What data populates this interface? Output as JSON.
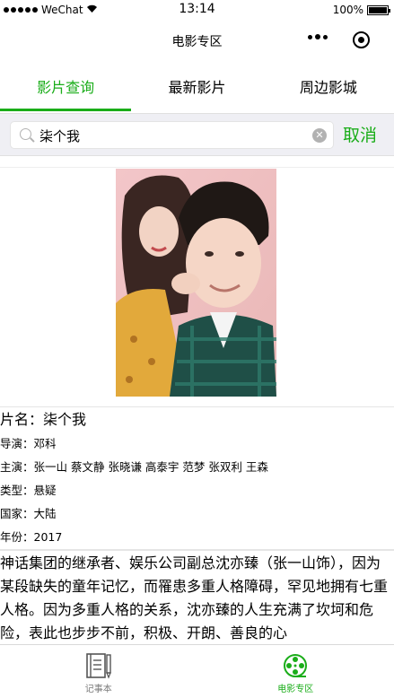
{
  "status_bar": {
    "carrier": "WeChat",
    "time": "13:14",
    "battery": "100%",
    "battery_level": 1.0
  },
  "nav": {
    "title": "电影专区"
  },
  "tabs": [
    {
      "label": "影片查询",
      "active": true
    },
    {
      "label": "最新影片",
      "active": false
    },
    {
      "label": "周边影城",
      "active": false
    }
  ],
  "search": {
    "value": "柒个我",
    "cancel_label": "取消"
  },
  "movie": {
    "name": "片名：柒个我",
    "director": "导演：邓科",
    "cast": "主演：张一山 蔡文静 张晓谦 高泰宇 范梦 张双利 王森",
    "genre": "类型：悬疑",
    "country": "国家：大陆",
    "year": "年份：2017",
    "synopsis": "神话集团的继承者、娱乐公司副总沈亦臻（张一山饰），因为某段缺失的童年记忆，而罹患多重人格障碍，罕见地拥有七重人格。因为多重人格的关系，沈亦臻的人生充满了坎坷和危险，表此也步步不前，积极、开朗、善良的心"
  },
  "tab_bar": [
    {
      "label": "记事本",
      "icon": "notebook-icon",
      "active": false
    },
    {
      "label": "电影专区",
      "icon": "film-reel-icon",
      "active": true
    }
  ],
  "colors": {
    "accent": "#1aad19",
    "search_bg": "#efeff4"
  }
}
